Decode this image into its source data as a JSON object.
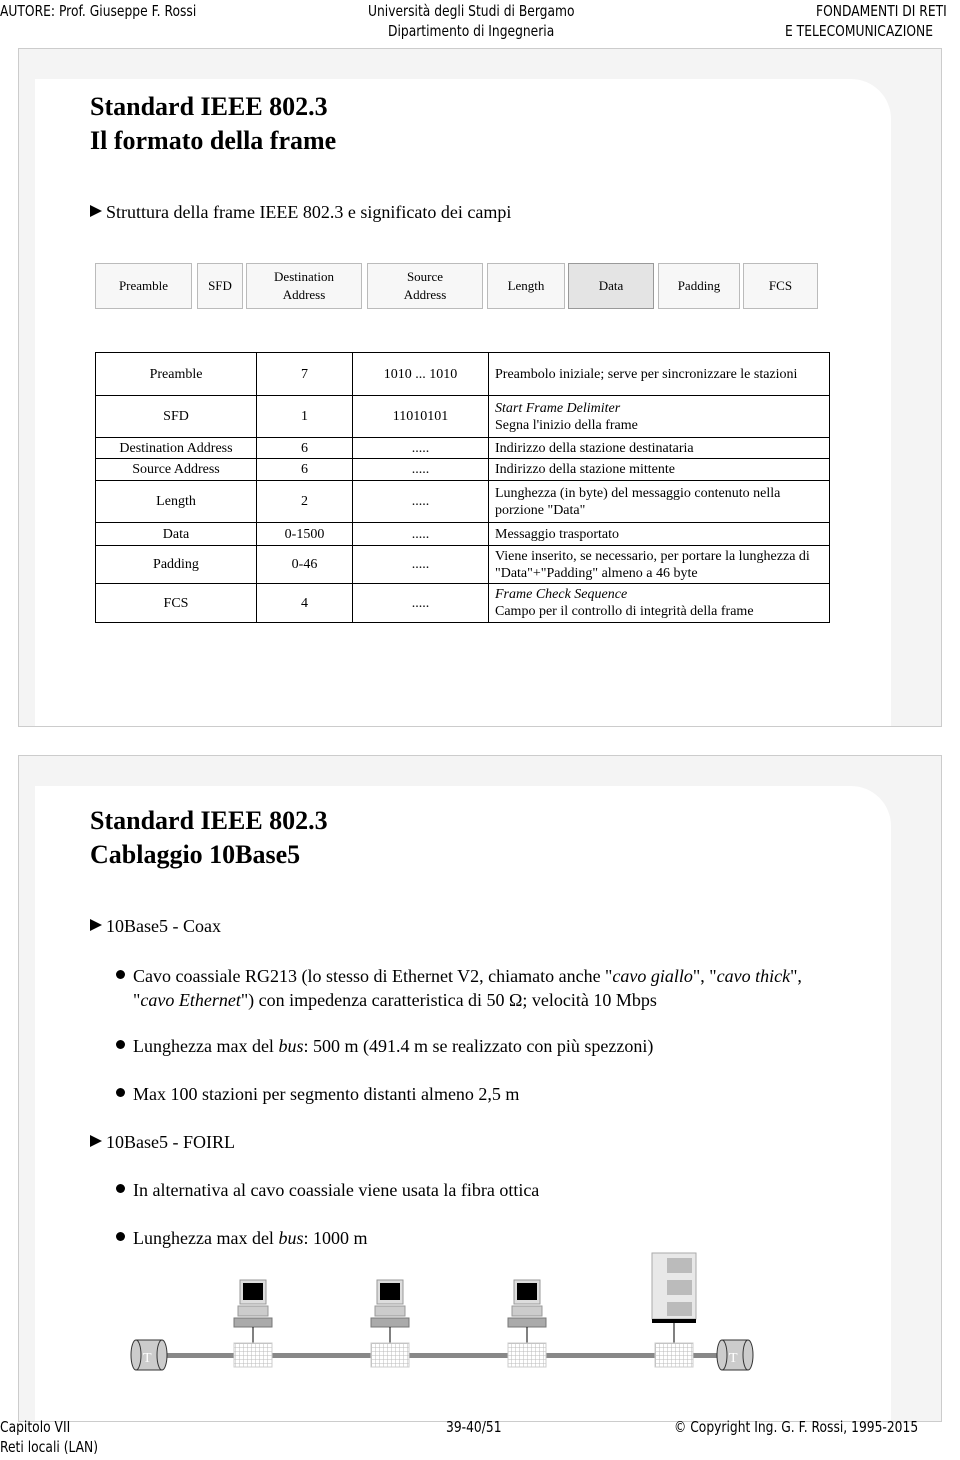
{
  "header": {
    "author": "AUTORE: Prof. Giuseppe F. Rossi",
    "university": "Università degli Studi di Bergamo",
    "department": "Dipartimento di Ingegneria",
    "course_line1": "FONDAMENTI DI RETI",
    "course_line2": "E TELECOMUNICAZIONE"
  },
  "slide1": {
    "title1": "Standard IEEE 802.3",
    "title2": "Il formato della frame",
    "bullet": "Struttura della frame IEEE 802.3 e significato dei campi",
    "frame_fields": [
      {
        "l1": "Preamble",
        "l2": ""
      },
      {
        "l1": "SFD",
        "l2": ""
      },
      {
        "l1": "Destination",
        "l2": "Address"
      },
      {
        "l1": "Source",
        "l2": "Address"
      },
      {
        "l1": "Length",
        "l2": ""
      },
      {
        "l1": "Data",
        "l2": ""
      },
      {
        "l1": "Padding",
        "l2": ""
      },
      {
        "l1": "FCS",
        "l2": ""
      }
    ],
    "table": [
      {
        "field": "Preamble",
        "bytes": "7",
        "value": "1010 ... 1010",
        "desc_it": "",
        "desc": "Preambolo iniziale; serve per sincronizzare le stazioni"
      },
      {
        "field": "SFD",
        "bytes": "1",
        "value": "11010101",
        "desc_it": "Start Frame Delimiter",
        "desc": "Segna l'inizio della frame"
      },
      {
        "field": "Destination Address",
        "bytes": "6",
        "value": ".....",
        "desc_it": "",
        "desc": "Indirizzo della stazione destinataria"
      },
      {
        "field": "Source Address",
        "bytes": "6",
        "value": ".....",
        "desc_it": "",
        "desc": "Indirizzo della stazione mittente"
      },
      {
        "field": "Length",
        "bytes": "2",
        "value": ".....",
        "desc_it": "",
        "desc": "Lunghezza (in byte) del messaggio contenuto nella porzione \"Data\""
      },
      {
        "field": "Data",
        "bytes": "0-1500",
        "value": ".....",
        "desc_it": "",
        "desc": "Messaggio trasportato"
      },
      {
        "field": "Padding",
        "bytes": "0-46",
        "value": ".....",
        "desc_it": "",
        "desc": "Viene inserito, se necessario, per portare la lunghezza di \"Data\"+\"Padding\" almeno a 46 byte"
      },
      {
        "field": "FCS",
        "bytes": "4",
        "value": ".....",
        "desc_it": "Frame Check Sequence",
        "desc": "Campo per il controllo di integrità della frame"
      }
    ]
  },
  "slide2": {
    "title1": "Standard IEEE 802.3",
    "title2": "Cablaggio 10Base5",
    "section1": "10Base5 - Coax",
    "b1a": "Cavo coassiale RG213 (lo stesso di Ethernet V2, chiamato anche \"",
    "b1b": "cavo giallo",
    "b1c": "\", \"",
    "b1d": "cavo thick",
    "b1e": "\",",
    "b1f": "\"",
    "b1g": "cavo Ethernet",
    "b1h": "\") con impedenza caratteristica di 50 Ω; velocità 10 Mbps",
    "b2a": "Lunghezza max del ",
    "b2b": "bus",
    "b2c": ": 500 m (491.4 m se realizzato con più spezzoni)",
    "b3": "Max 100 stazioni per segmento distanti almeno 2,5 m",
    "section2": "10Base5 - FOIRL",
    "b4": "In alternativa al cavo coassiale viene usata la fibra ottica",
    "b5a": "Lunghezza max del ",
    "b5b": "bus",
    "b5c": ": 1000 m",
    "terminator_label": "T"
  },
  "footer": {
    "chapter": "Capitolo VII",
    "topic": "Reti locali (LAN)",
    "pages": "39-40/51",
    "copyright": "© Copyright Ing. G. F. Rossi, 1995-2015"
  }
}
